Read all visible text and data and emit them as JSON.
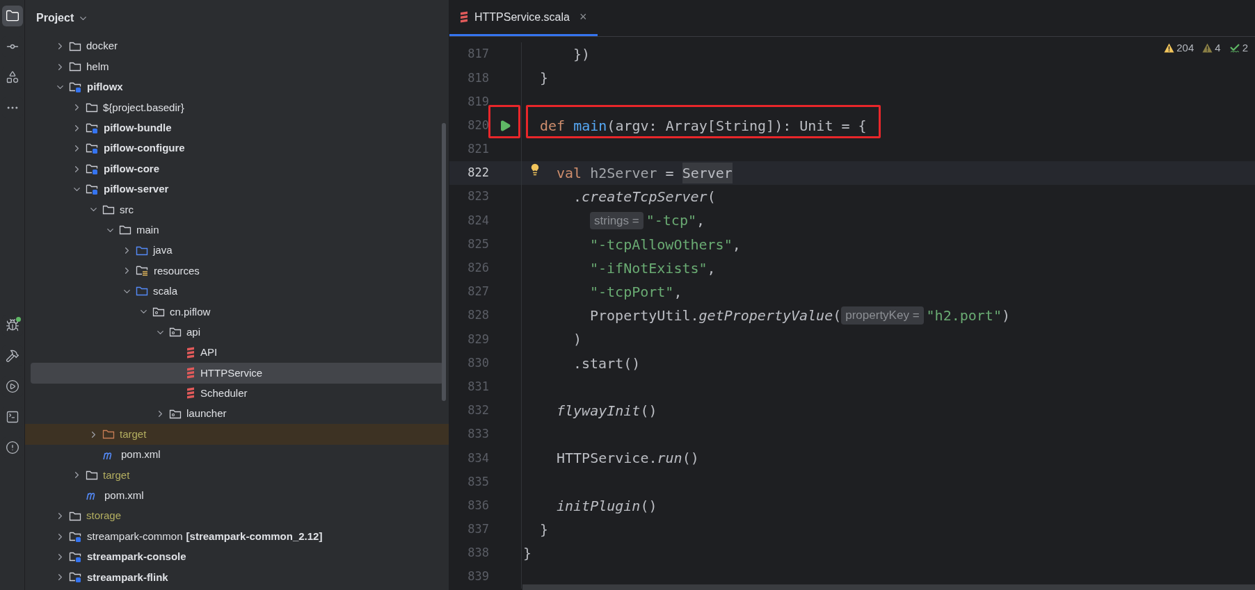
{
  "tool_stripe": {
    "top": [
      {
        "kind": "folder",
        "selected": true
      },
      {
        "kind": "commit",
        "selected": false
      },
      {
        "kind": "structure",
        "selected": false
      },
      {
        "kind": "more",
        "selected": false
      }
    ],
    "bottom": [
      {
        "kind": "debug",
        "selected": false
      },
      {
        "kind": "build",
        "selected": false
      },
      {
        "kind": "services",
        "selected": false
      },
      {
        "kind": "terminal",
        "selected": false
      },
      {
        "kind": "problems",
        "selected": false
      }
    ]
  },
  "project_panel": {
    "title": "Project",
    "tree": [
      {
        "label": "docker",
        "kind": "folder",
        "expanded": false,
        "selected": false
      },
      {
        "label": "helm",
        "kind": "folder",
        "expanded": false,
        "selected": false
      },
      {
        "label": "piflowx",
        "kind": "module",
        "bold": true,
        "expanded": true,
        "selected": false,
        "children": [
          {
            "label": "${project.basedir}",
            "kind": "folder",
            "expanded": false,
            "selected": false
          },
          {
            "label": "piflow-bundle",
            "kind": "module",
            "bold": true,
            "expanded": false,
            "selected": false
          },
          {
            "label": "piflow-configure",
            "kind": "module",
            "bold": true,
            "expanded": false,
            "selected": false
          },
          {
            "label": "piflow-core",
            "kind": "module",
            "bold": true,
            "expanded": false,
            "selected": false
          },
          {
            "label": "piflow-server",
            "kind": "module",
            "bold": true,
            "expanded": true,
            "selected": false,
            "children": [
              {
                "label": "src",
                "kind": "folder",
                "expanded": true,
                "selected": false,
                "children": [
                  {
                    "label": "main",
                    "kind": "folder",
                    "expanded": true,
                    "selected": false,
                    "children": [
                      {
                        "label": "java",
                        "kind": "source",
                        "expanded": false,
                        "selected": false
                      },
                      {
                        "label": "resources",
                        "kind": "resources",
                        "expanded": false,
                        "selected": false
                      },
                      {
                        "label": "scala",
                        "kind": "source",
                        "expanded": true,
                        "selected": false,
                        "children": [
                          {
                            "label": "cn.piflow",
                            "kind": "package",
                            "expanded": true,
                            "selected": false,
                            "children": [
                              {
                                "label": "api",
                                "kind": "package",
                                "expanded": true,
                                "selected": false,
                                "children": [
                                  {
                                    "label": "API",
                                    "kind": "scala",
                                    "selected": false
                                  },
                                  {
                                    "label": "HTTPService",
                                    "kind": "scala",
                                    "selected": true
                                  },
                                  {
                                    "label": "Scheduler",
                                    "kind": "scala",
                                    "selected": false
                                  }
                                ]
                              },
                              {
                                "label": "launcher",
                                "kind": "package",
                                "expanded": false,
                                "selected": false
                              }
                            ]
                          }
                        ]
                      }
                    ]
                  }
                ]
              },
              {
                "label": "target",
                "kind": "excluded",
                "ignored": true,
                "highlighted": true,
                "expanded": false,
                "selected": false
              },
              {
                "label": "pom.xml",
                "kind": "maven",
                "selected": false
              }
            ]
          },
          {
            "label": "target",
            "kind": "folder",
            "ignored": true,
            "expanded": false,
            "selected": false
          },
          {
            "label": "pom.xml",
            "kind": "maven",
            "selected": false
          }
        ]
      },
      {
        "label": "storage",
        "kind": "folder",
        "ignored": true,
        "expanded": false,
        "selected": false
      },
      {
        "label": "streampark-common",
        "suffix": "[streampark-common_2.12]",
        "kind": "module",
        "expanded": false,
        "selected": false
      },
      {
        "label": "streampark-console",
        "kind": "module",
        "bold": true,
        "expanded": false,
        "selected": false
      },
      {
        "label": "streampark-flink",
        "kind": "module",
        "bold": true,
        "expanded": false,
        "selected": false
      }
    ]
  },
  "editor": {
    "tabs": [
      {
        "label": "HTTPService.scala",
        "close": "×",
        "selected": true
      }
    ],
    "inspections": [
      {
        "kind": "warning",
        "count": "204"
      },
      {
        "kind": "weak-warning",
        "count": "4"
      },
      {
        "kind": "typo",
        "count": "2"
      }
    ],
    "lines": [
      {
        "number": "817",
        "kind": "chain",
        "tokens": [
          {
            "text": "})",
            "kind": "plain"
          }
        ]
      },
      {
        "number": "818",
        "kind": "member",
        "tokens": [
          {
            "text": "}",
            "kind": "plain"
          }
        ]
      },
      {
        "number": "819"
      },
      {
        "number": "820",
        "run": true,
        "annotated": true,
        "kind": "member",
        "tokens": [
          {
            "text": "def ",
            "kind": "kw"
          },
          {
            "text": "main",
            "kind": "fn"
          },
          {
            "text": "(argv: Array[String]): Unit = {",
            "kind": "plain"
          }
        ]
      },
      {
        "number": "821"
      },
      {
        "number": "822",
        "current": true,
        "bulb": true,
        "kind": "body",
        "tokens": [
          {
            "text": "val ",
            "kind": "kw"
          },
          {
            "text": "h2Server",
            "kind": "dim"
          },
          {
            "text": " = ",
            "kind": "plain"
          },
          {
            "text": "Server",
            "kind": "mark"
          }
        ]
      },
      {
        "number": "823",
        "kind": "chain",
        "tokens": [
          {
            "text": ".",
            "kind": "plain"
          },
          {
            "text": "createTcpServer",
            "kind": "italic"
          },
          {
            "text": "(",
            "kind": "plain"
          }
        ]
      },
      {
        "number": "824",
        "kind": "args",
        "tokens": [
          {
            "text": "strings =",
            "kind": "hint"
          },
          {
            "text": "\"-tcp\"",
            "kind": "str"
          },
          {
            "text": ",",
            "kind": "plain"
          }
        ]
      },
      {
        "number": "825",
        "kind": "args",
        "tokens": [
          {
            "text": "\"-tcpAllowOthers\"",
            "kind": "str"
          },
          {
            "text": ",",
            "kind": "plain"
          }
        ]
      },
      {
        "number": "826",
        "kind": "args",
        "tokens": [
          {
            "text": "\"-ifNotExists\"",
            "kind": "str"
          },
          {
            "text": ",",
            "kind": "plain"
          }
        ]
      },
      {
        "number": "827",
        "kind": "args",
        "tokens": [
          {
            "text": "\"-tcpPort\"",
            "kind": "str"
          },
          {
            "text": ",",
            "kind": "plain"
          }
        ]
      },
      {
        "number": "828",
        "kind": "args",
        "tokens": [
          {
            "text": "PropertyUtil.",
            "kind": "plain"
          },
          {
            "text": "getPropertyValue",
            "kind": "italic"
          },
          {
            "text": "(",
            "kind": "plain"
          },
          {
            "text": "propertyKey =",
            "kind": "hint"
          },
          {
            "text": "\"h2.port\"",
            "kind": "str"
          },
          {
            "text": ")",
            "kind": "plain"
          }
        ]
      },
      {
        "number": "829",
        "kind": "chain",
        "tokens": [
          {
            "text": ")",
            "kind": "plain"
          }
        ]
      },
      {
        "number": "830",
        "kind": "chain",
        "tokens": [
          {
            "text": ".start()",
            "kind": "plain"
          }
        ]
      },
      {
        "number": "831"
      },
      {
        "number": "832",
        "kind": "body",
        "tokens": [
          {
            "text": "flywayInit",
            "kind": "italic"
          },
          {
            "text": "()",
            "kind": "plain"
          }
        ]
      },
      {
        "number": "833"
      },
      {
        "number": "834",
        "kind": "body",
        "tokens": [
          {
            "text": "HTTPService.",
            "kind": "plain"
          },
          {
            "text": "run",
            "kind": "italic"
          },
          {
            "text": "()",
            "kind": "plain"
          }
        ]
      },
      {
        "number": "835"
      },
      {
        "number": "836",
        "kind": "body",
        "tokens": [
          {
            "text": "initPlugin",
            "kind": "italic"
          },
          {
            "text": "()",
            "kind": "plain"
          }
        ]
      },
      {
        "number": "837",
        "kind": "member",
        "tokens": [
          {
            "text": "}",
            "kind": "plain"
          }
        ]
      },
      {
        "number": "838",
        "kind": "top",
        "tokens": [
          {
            "text": "}",
            "kind": "plain"
          }
        ]
      },
      {
        "number": "839"
      }
    ]
  }
}
